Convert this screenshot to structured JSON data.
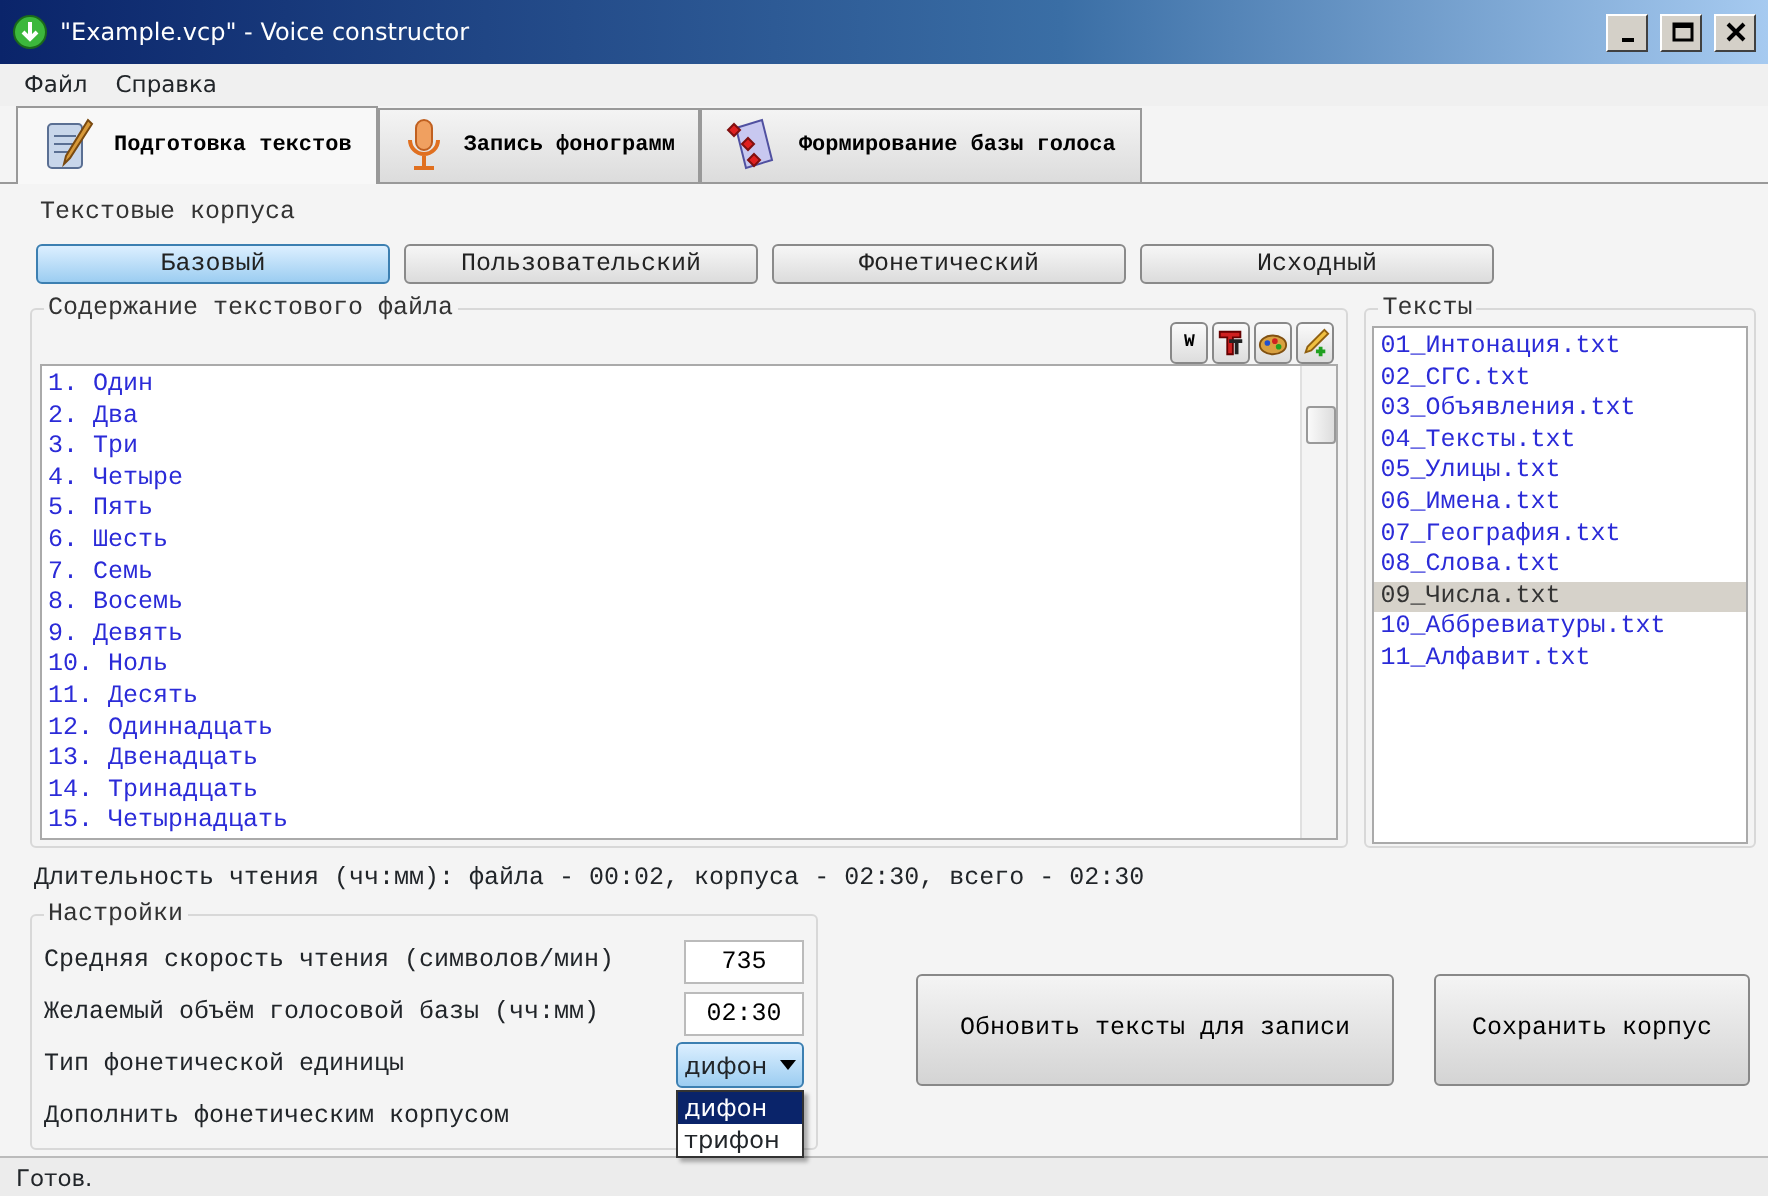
{
  "window": {
    "title": "\"Example.vcp\" - Voice constructor"
  },
  "menu": [
    "Файл",
    "Справка"
  ],
  "tabs": [
    {
      "label": "Подготовка текстов",
      "selected": true,
      "kind": "scroll"
    },
    {
      "label": "Запись фонограмм",
      "selected": false,
      "kind": "mic"
    },
    {
      "label": "Формирование базы голоса",
      "selected": false,
      "kind": "diamonds"
    }
  ],
  "corpus_group": {
    "title": "Текстовые корпуса",
    "buttons": [
      {
        "label": "Базовый",
        "selected": true
      },
      {
        "label": "Пользовательский",
        "selected": false
      },
      {
        "label": "Фонетический",
        "selected": false
      },
      {
        "label": "Исходный",
        "selected": false
      }
    ]
  },
  "file_content": {
    "title": "Содержание текстового файла",
    "tools": [
      "W"
    ],
    "lines": [
      "1. Один",
      "2. Два",
      "3. Три",
      "4. Четыре",
      "5. Пять",
      "6. Шесть",
      "7. Семь",
      "8. Восемь",
      "9. Девять",
      "10. Ноль",
      "11. Десять",
      "12. Одиннадцать",
      "13. Двенадцать",
      "14. Тринадцать",
      "15. Четырнадцать"
    ]
  },
  "texts": {
    "title": "Тексты",
    "items": [
      {
        "label": "01_Интонация.txt",
        "selected": false
      },
      {
        "label": "02_СГС.txt",
        "selected": false
      },
      {
        "label": "03_Объявления.txt",
        "selected": false
      },
      {
        "label": "04_Тексты.txt",
        "selected": false
      },
      {
        "label": "05_Улицы.txt",
        "selected": false
      },
      {
        "label": "06_Имена.txt",
        "selected": false
      },
      {
        "label": "07_География.txt",
        "selected": false
      },
      {
        "label": "08_Слова.txt",
        "selected": false
      },
      {
        "label": "09_Числа.txt",
        "selected": true
      },
      {
        "label": "10_Аббревиатуры.txt",
        "selected": false
      },
      {
        "label": "11_Алфавит.txt",
        "selected": false
      }
    ]
  },
  "duration": "Длительность чтения (чч:мм): файла - 00:02, корпуса - 02:30, всего - 02:30",
  "settings": {
    "title": "Настройки",
    "rows": [
      {
        "kind": "input",
        "label": "Средняя скорость чтения (символов/мин)",
        "value": "735"
      },
      {
        "kind": "input",
        "label": "Желаемый объём голосовой базы (чч:мм)",
        "value": "02:30"
      },
      {
        "kind": "select",
        "label": "Тип фонетической единицы",
        "value": "дифон",
        "expanded": true,
        "options": [
          {
            "label": "дифон",
            "selected": true
          },
          {
            "label": "трифон",
            "selected": false
          }
        ]
      },
      {
        "kind": "label",
        "label": "Дополнить фонетическим корпусом"
      }
    ]
  },
  "buttons": [
    "Обновить тексты для записи",
    "Сохранить корпус"
  ],
  "status_bar": "Готов."
}
